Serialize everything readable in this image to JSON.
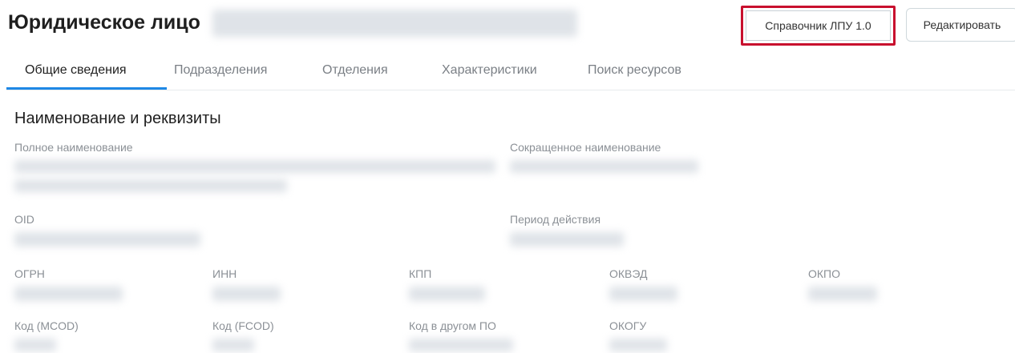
{
  "header": {
    "title": "Юридическое лицо",
    "buttons": {
      "reference_label": "Справочник ЛПУ 1.0",
      "edit_label": "Редактировать"
    },
    "highlight_color": "#c8102e"
  },
  "tabs": [
    {
      "label": "Общие сведения",
      "active": true
    },
    {
      "label": "Подразделения",
      "active": false
    },
    {
      "label": "Отделения",
      "active": false
    },
    {
      "label": "Характеристики",
      "active": false
    },
    {
      "label": "Поиск ресурсов",
      "active": false
    }
  ],
  "accent_color": "#1e88e5",
  "section": {
    "title": "Наименование и реквизиты",
    "fields": {
      "full_name": "Полное наименование",
      "short_name": "Сокращенное наименование",
      "oid": "OID",
      "period": "Период действия",
      "ogrn": "ОГРН",
      "inn": "ИНН",
      "kpp": "КПП",
      "okved": "ОКВЭД",
      "okpo": "ОКПО",
      "mcod": "Код (MCOD)",
      "fcod": "Код (FCOD)",
      "other_code": "Код в другом ПО",
      "okogu": "ОКОГУ"
    }
  }
}
